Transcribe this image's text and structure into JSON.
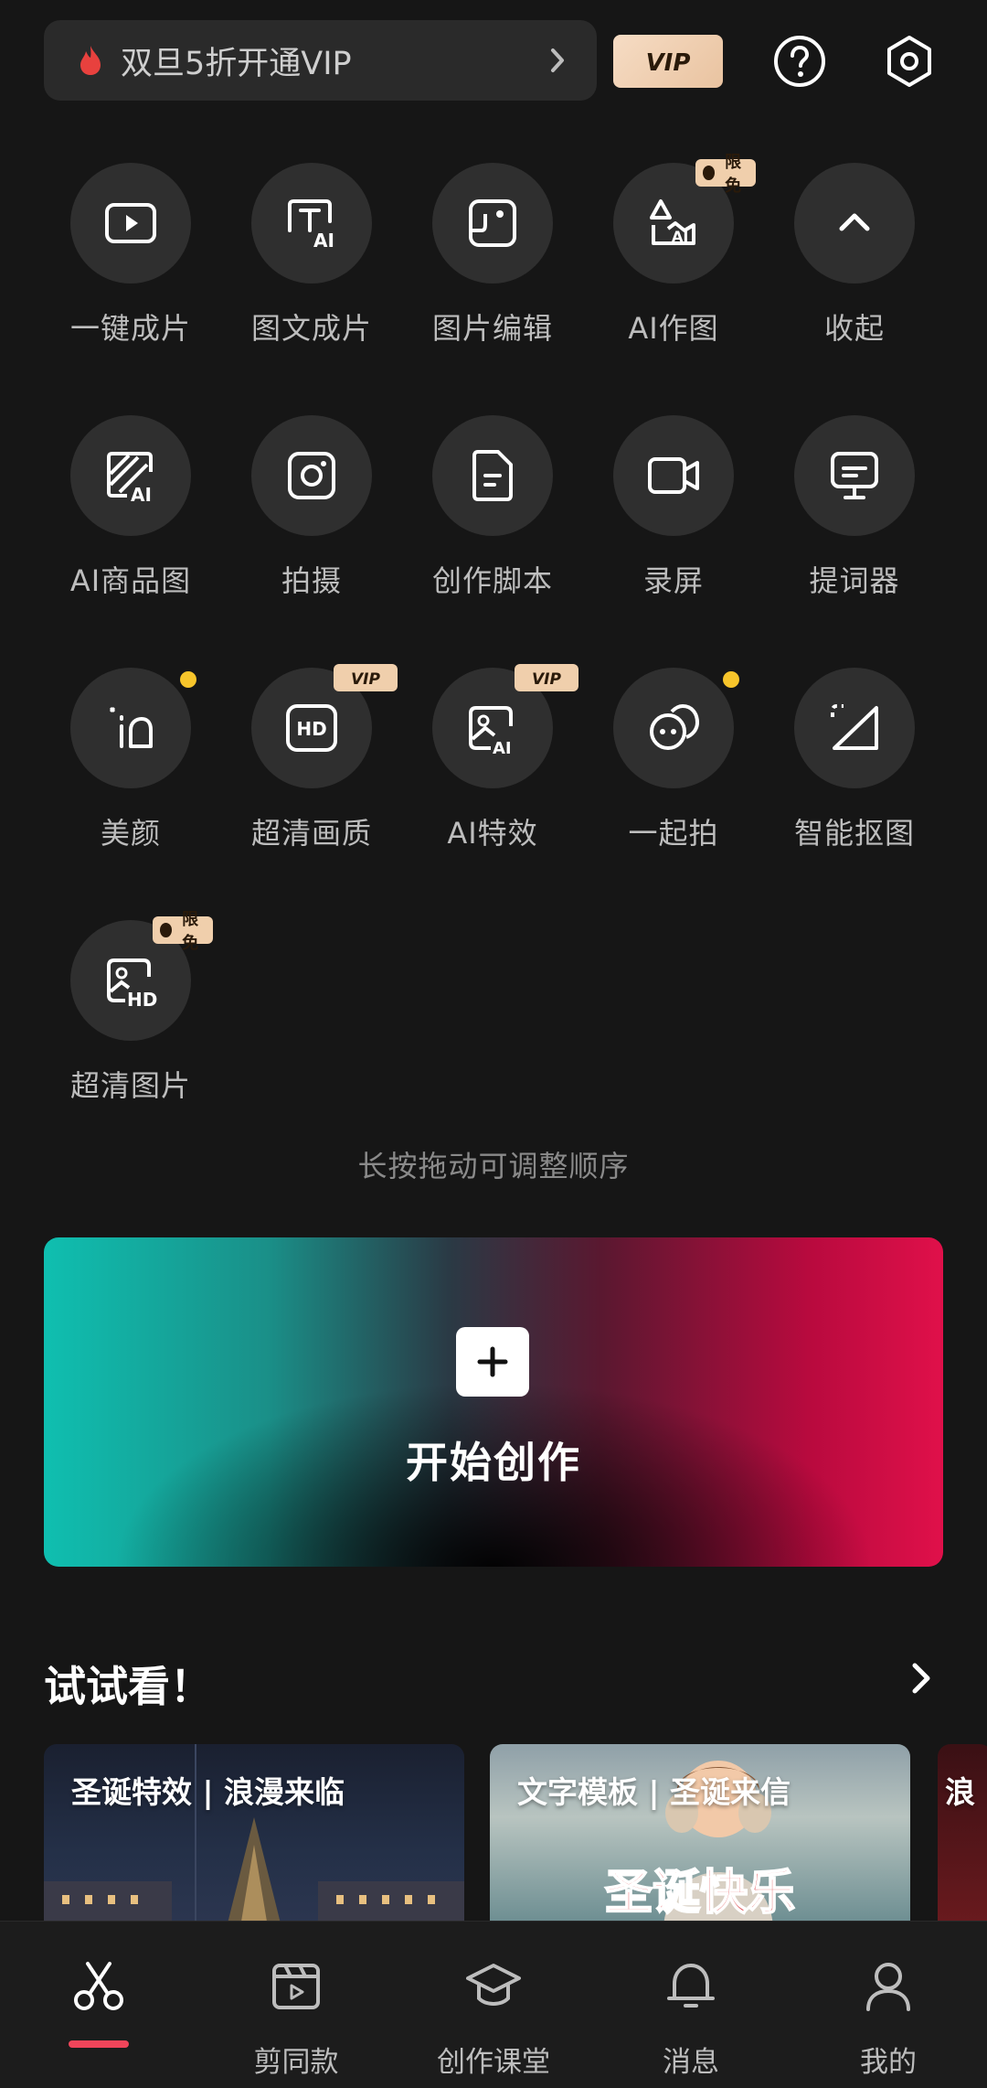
{
  "top": {
    "promo_text": "双旦5折开通VIP",
    "vip_label": "VIP"
  },
  "tools": [
    {
      "label": "一键成片",
      "icon": "play-video-icon"
    },
    {
      "label": "图文成片",
      "icon": "text-ai-icon",
      "name": "text-to-video"
    },
    {
      "label": "图片编辑",
      "icon": "image-edit-icon"
    },
    {
      "label": "AI作图",
      "icon": "ai-draw-icon",
      "badge": "限免"
    },
    {
      "label": "收起",
      "icon": "chevron-up-icon"
    },
    {
      "label": "AI商品图",
      "icon": "ai-product-icon"
    },
    {
      "label": "拍摄",
      "icon": "camera-icon"
    },
    {
      "label": "创作脚本",
      "icon": "script-icon"
    },
    {
      "label": "录屏",
      "icon": "screen-record-icon"
    },
    {
      "label": "提词器",
      "icon": "teleprompter-icon"
    },
    {
      "label": "美颜",
      "icon": "beauty-icon"
    },
    {
      "label": "超清画质",
      "icon": "hd-icon",
      "badge": "VIP"
    },
    {
      "label": "AI特效",
      "icon": "ai-effect-icon",
      "badge": "VIP"
    },
    {
      "label": "一起拍",
      "icon": "duet-icon"
    },
    {
      "label": "智能抠图",
      "icon": "cutout-icon"
    },
    {
      "label": "超清图片",
      "icon": "hd-image-icon",
      "badge": "限免"
    }
  ],
  "hint": "长按拖动可调整顺序",
  "create": {
    "label": "开始创作"
  },
  "try": {
    "title": "试试看！",
    "cards": [
      {
        "title": "圣诞特效 | 浪漫来临"
      },
      {
        "title": "文字模板 | 圣诞来信"
      },
      {
        "title": "浪"
      }
    ],
    "card2_art_text": "圣诞快乐"
  },
  "nav": [
    {
      "label": "",
      "icon": "scissors-icon",
      "active": true
    },
    {
      "label": "剪同款",
      "icon": "clapper-icon"
    },
    {
      "label": "创作课堂",
      "icon": "graduation-cap-icon"
    },
    {
      "label": "消息",
      "icon": "bell-icon"
    },
    {
      "label": "我的",
      "icon": "person-icon"
    }
  ],
  "colors": {
    "accent": "#f0455a",
    "vip_gold": "#f0cfac",
    "dot": "#f7c52b"
  }
}
